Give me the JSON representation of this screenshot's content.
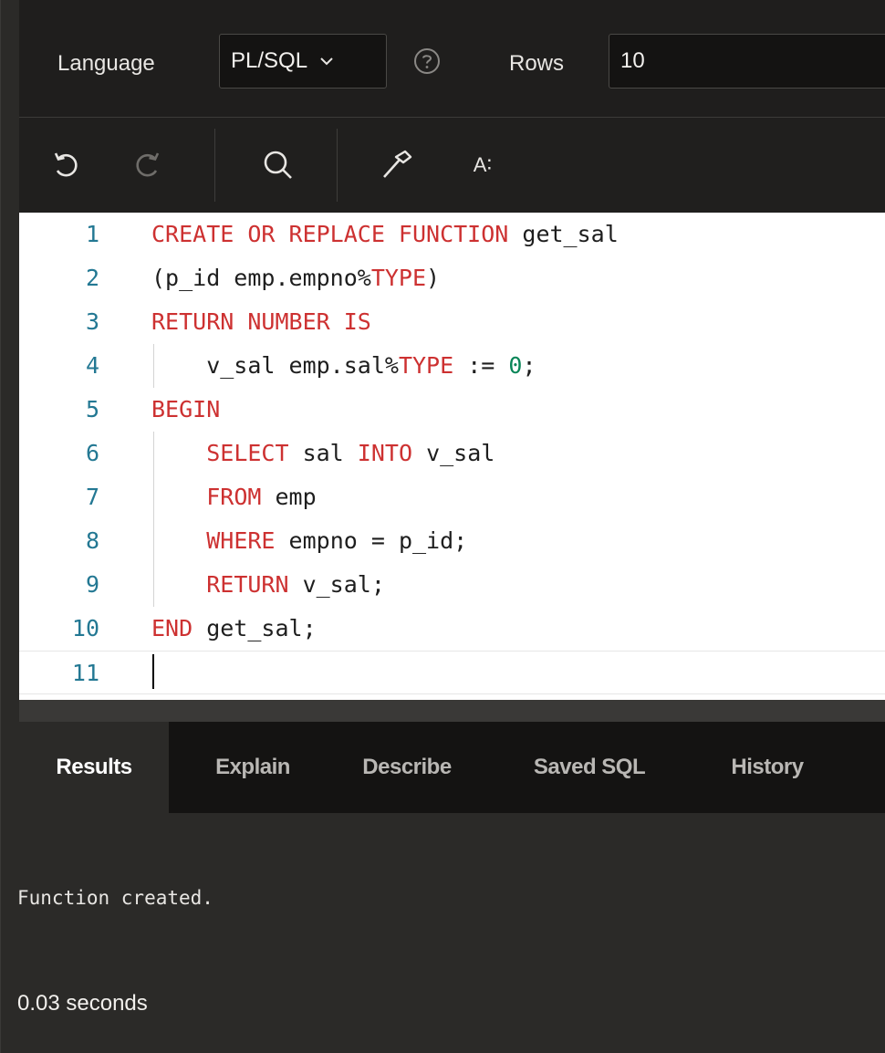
{
  "settings": {
    "language_label": "Language",
    "language_value": "PL/SQL",
    "rows_label": "Rows",
    "rows_value": "10"
  },
  "toolbar": {
    "undo_icon": "undo-icon",
    "redo_icon": "redo-icon",
    "search_icon": "search-icon",
    "hammer_icon": "hammer-icon",
    "format_label": "A∶"
  },
  "editor": {
    "lines": [
      {
        "n": "1",
        "tokens": [
          [
            "kw",
            "CREATE OR REPLACE FUNCTION"
          ],
          [
            "tx",
            " get_sal"
          ]
        ]
      },
      {
        "n": "2",
        "tokens": [
          [
            "tx",
            "(p_id emp.empno%"
          ],
          [
            "kw",
            "TYPE"
          ],
          [
            "tx",
            ")"
          ]
        ]
      },
      {
        "n": "3",
        "tokens": [
          [
            "kw",
            "RETURN NUMBER IS"
          ]
        ]
      },
      {
        "n": "4",
        "tokens": [
          [
            "tx",
            "    v_sal emp.sal%"
          ],
          [
            "kw",
            "TYPE"
          ],
          [
            "tx",
            " := "
          ],
          [
            "num",
            "0"
          ],
          [
            "tx",
            ";"
          ]
        ]
      },
      {
        "n": "5",
        "tokens": [
          [
            "kw",
            "BEGIN"
          ]
        ]
      },
      {
        "n": "6",
        "tokens": [
          [
            "tx",
            "    "
          ],
          [
            "kw",
            "SELECT"
          ],
          [
            "tx",
            " sal "
          ],
          [
            "kw",
            "INTO"
          ],
          [
            "tx",
            " v_sal"
          ]
        ]
      },
      {
        "n": "7",
        "tokens": [
          [
            "tx",
            "    "
          ],
          [
            "kw",
            "FROM"
          ],
          [
            "tx",
            " emp"
          ]
        ]
      },
      {
        "n": "8",
        "tokens": [
          [
            "tx",
            "    "
          ],
          [
            "kw",
            "WHERE"
          ],
          [
            "tx",
            " empno = p_id;"
          ]
        ]
      },
      {
        "n": "9",
        "tokens": [
          [
            "tx",
            "    "
          ],
          [
            "kw",
            "RETURN"
          ],
          [
            "tx",
            " v_sal;"
          ]
        ]
      },
      {
        "n": "10",
        "tokens": [
          [
            "kw",
            "END"
          ],
          [
            "tx",
            " get_sal;"
          ]
        ]
      },
      {
        "n": "11",
        "tokens": []
      }
    ]
  },
  "tabs": [
    {
      "label": "Results",
      "active": true
    },
    {
      "label": "Explain",
      "active": false
    },
    {
      "label": "Describe",
      "active": false
    },
    {
      "label": "Saved SQL",
      "active": false
    },
    {
      "label": "History",
      "active": false
    }
  ],
  "output": {
    "message": "Function created.",
    "time": "0.03 seconds"
  },
  "colors": {
    "keyword": "#cd3131",
    "number": "#098658",
    "line_number": "#237893",
    "background": "#2b2a28"
  }
}
